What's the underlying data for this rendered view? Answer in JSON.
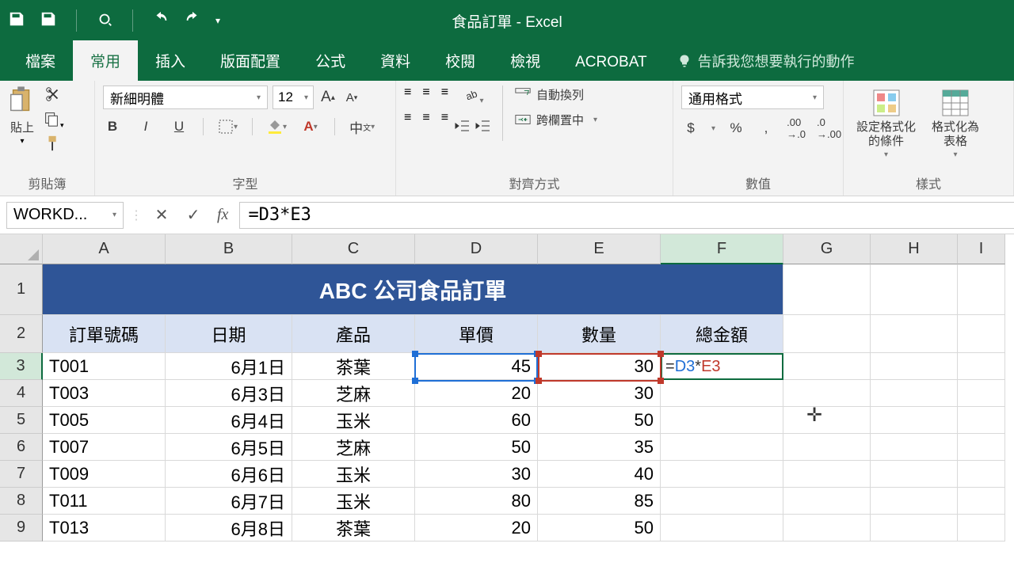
{
  "app": {
    "title": "食品訂單 - Excel"
  },
  "tabs": {
    "file": "檔案",
    "home": "常用",
    "insert": "插入",
    "layout": "版面配置",
    "formulas": "公式",
    "data": "資料",
    "review": "校閱",
    "view": "檢視",
    "acrobat": "ACROBAT",
    "tell": "告訴我您想要執行的動作"
  },
  "ribbon": {
    "clipboard": {
      "label": "剪貼簿",
      "paste": "貼上"
    },
    "font": {
      "label": "字型",
      "name": "新細明體",
      "size": "12",
      "bold": "B",
      "italic": "I",
      "underline": "U",
      "phonetic": "中"
    },
    "align": {
      "label": "對齊方式",
      "wrap": "自動換列",
      "merge": "跨欄置中"
    },
    "number": {
      "label": "數值",
      "format": "通用格式",
      "currency": "$",
      "percent": "%",
      "comma": ","
    },
    "styles": {
      "label": "樣式",
      "cond": "設定格式化\n的條件",
      "table": "格式化為\n表格"
    }
  },
  "fbar": {
    "name": "WORKD...",
    "formula": "=D3*E3"
  },
  "grid": {
    "columns": [
      "A",
      "B",
      "C",
      "D",
      "E",
      "F",
      "G",
      "H",
      "I"
    ],
    "rows": [
      "1",
      "2",
      "3",
      "4",
      "5",
      "6",
      "7",
      "8",
      "9"
    ],
    "title": "ABC 公司食品訂單",
    "headers": [
      "訂單號碼",
      "日期",
      "產品",
      "單價",
      "數量",
      "總金額"
    ],
    "data": [
      {
        "a": "T001",
        "b": "6月1日",
        "c": "茶葉",
        "d": "45",
        "e": "30",
        "f": "=D3*E3"
      },
      {
        "a": "T003",
        "b": "6月3日",
        "c": "芝麻",
        "d": "20",
        "e": "30",
        "f": ""
      },
      {
        "a": "T005",
        "b": "6月4日",
        "c": "玉米",
        "d": "60",
        "e": "50",
        "f": ""
      },
      {
        "a": "T007",
        "b": "6月5日",
        "c": "芝麻",
        "d": "50",
        "e": "35",
        "f": ""
      },
      {
        "a": "T009",
        "b": "6月6日",
        "c": "玉米",
        "d": "30",
        "e": "40",
        "f": ""
      },
      {
        "a": "T011",
        "b": "6月7日",
        "c": "玉米",
        "d": "80",
        "e": "85",
        "f": ""
      },
      {
        "a": "T013",
        "b": "6月8日",
        "c": "茶葉",
        "d": "20",
        "e": "50",
        "f": ""
      }
    ],
    "active_formula_parts": {
      "eq": "=",
      "r1": "D3",
      "op": "*",
      "r2": "E3"
    }
  }
}
